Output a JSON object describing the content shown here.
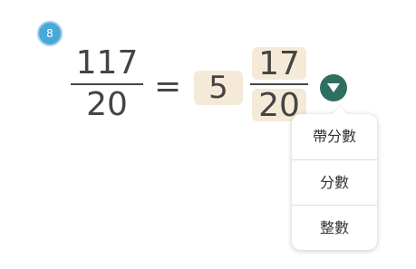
{
  "question": {
    "number": "8"
  },
  "improper_fraction": {
    "numerator": "117",
    "denominator": "20"
  },
  "equals_sign": "=",
  "mixed_number": {
    "whole": "5",
    "numerator": "17",
    "denominator": "20"
  },
  "format_menu": {
    "options": [
      "帶分數",
      "分數",
      "整數"
    ]
  },
  "colors": {
    "badge": "#4aa8d8",
    "answer_box": "#f5ead8",
    "toggle_button": "#2f6f62"
  }
}
